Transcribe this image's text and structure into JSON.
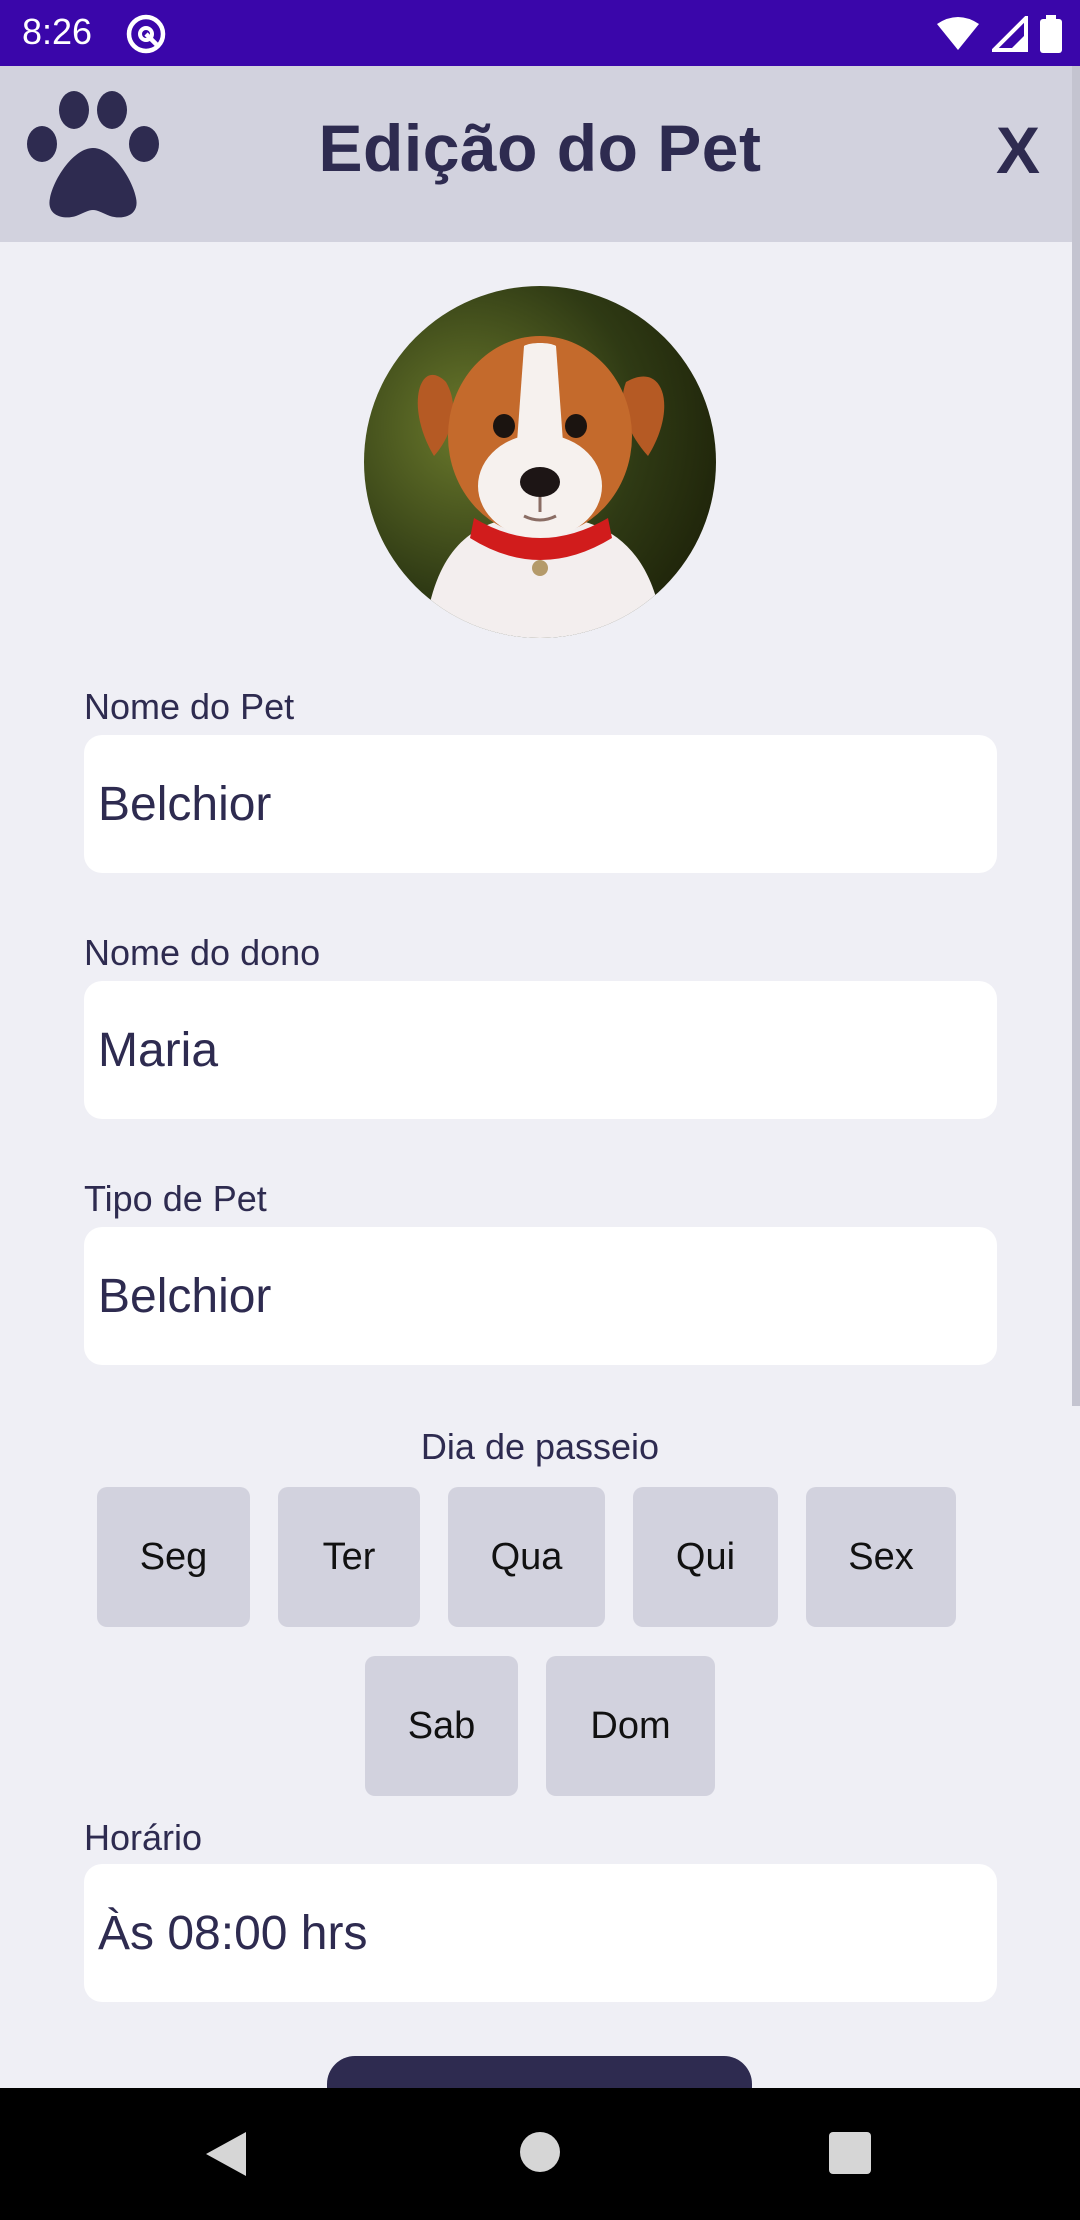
{
  "status_bar": {
    "time": "8:26",
    "icons": [
      "app-notification-icon",
      "wifi-icon",
      "signal-icon",
      "battery-icon"
    ]
  },
  "app_bar": {
    "logo_icon": "paw-icon",
    "title": "Edição do Pet",
    "close_label": "X"
  },
  "avatar": {
    "alt": "Foto do pet"
  },
  "form": {
    "pet_name": {
      "label": "Nome do Pet",
      "value": "Belchior"
    },
    "owner_name": {
      "label": "Nome do dono",
      "value": "Maria"
    },
    "pet_type": {
      "label": "Tipo de Pet",
      "value": "Belchior"
    },
    "walk_days": {
      "label": "Dia de passeio",
      "days": [
        "Seg",
        "Ter",
        "Qua",
        "Qui",
        "Sex",
        "Sab",
        "Dom"
      ]
    },
    "time": {
      "label": "Horário",
      "value": "Às 08:00 hrs"
    }
  },
  "nav_bar": {
    "icons": [
      "back-icon",
      "home-icon",
      "recents-icon"
    ]
  },
  "colors": {
    "status_bar": "#3a06aa",
    "app_bar": "#d2d2de",
    "background": "#efeff5",
    "primary_text": "#2e2b50",
    "day_button": "#d2d2de",
    "field_background": "#ffffff"
  }
}
